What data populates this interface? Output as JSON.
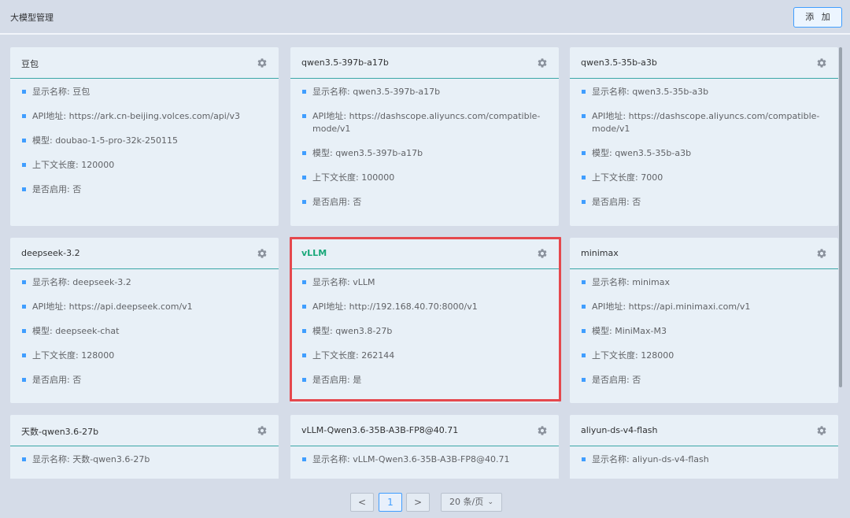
{
  "header": {
    "title": "大模型管理",
    "add_label": "添 加"
  },
  "labels": {
    "display_name": "显示名称: ",
    "api_address": "API地址: ",
    "model": "模型: ",
    "context_length": "上下文长度: ",
    "enabled": "是否启用: "
  },
  "cards": [
    {
      "title": "豆包",
      "display_name": "豆包",
      "api": "https://ark.cn-beijing.volces.com/api/v3",
      "model": "doubao-1-5-pro-32k-250115",
      "context": "120000",
      "enabled": "否"
    },
    {
      "title": "qwen3.5-397b-a17b",
      "display_name": "qwen3.5-397b-a17b",
      "api": "https://dashscope.aliyuncs.com/compatible-mode/v1",
      "model": "qwen3.5-397b-a17b",
      "context": "100000",
      "enabled": "否"
    },
    {
      "title": "qwen3.5-35b-a3b",
      "display_name": "qwen3.5-35b-a3b",
      "api": "https://dashscope.aliyuncs.com/compatible-mode/v1",
      "model": "qwen3.5-35b-a3b",
      "context": "7000",
      "enabled": "否"
    },
    {
      "title": "deepseek-3.2",
      "display_name": "deepseek-3.2",
      "api": "https://api.deepseek.com/v1",
      "model": "deepseek-chat",
      "context": "128000",
      "enabled": "否"
    },
    {
      "title": "vLLM",
      "display_name": "vLLM",
      "api": "http://192.168.40.70:8000/v1",
      "model": "qwen3.8-27b",
      "context": "262144",
      "enabled": "是"
    },
    {
      "title": "minimax",
      "display_name": "minimax",
      "api": "https://api.minimaxi.com/v1",
      "model": "MiniMax-M3",
      "context": "128000",
      "enabled": "否"
    },
    {
      "title": "天数-qwen3.6-27b",
      "display_name": "天数-qwen3.6-27b"
    },
    {
      "title": "vLLM-Qwen3.6-35B-A3B-FP8@40.71",
      "display_name": "vLLM-Qwen3.6-35B-A3B-FP8@40.71"
    },
    {
      "title": "aliyun-ds-v4-flash",
      "display_name": "aliyun-ds-v4-flash"
    }
  ],
  "pagination": {
    "prev": "<",
    "current_page": "1",
    "next": ">",
    "page_size": "20 条/页"
  },
  "colors": {
    "accent": "#409eff",
    "active_title": "#1aa87a",
    "highlight_border": "#e5484d",
    "divider": "#3ba7a7"
  },
  "icons": {
    "settings": "gear-icon",
    "bullet": "square-bullet"
  }
}
